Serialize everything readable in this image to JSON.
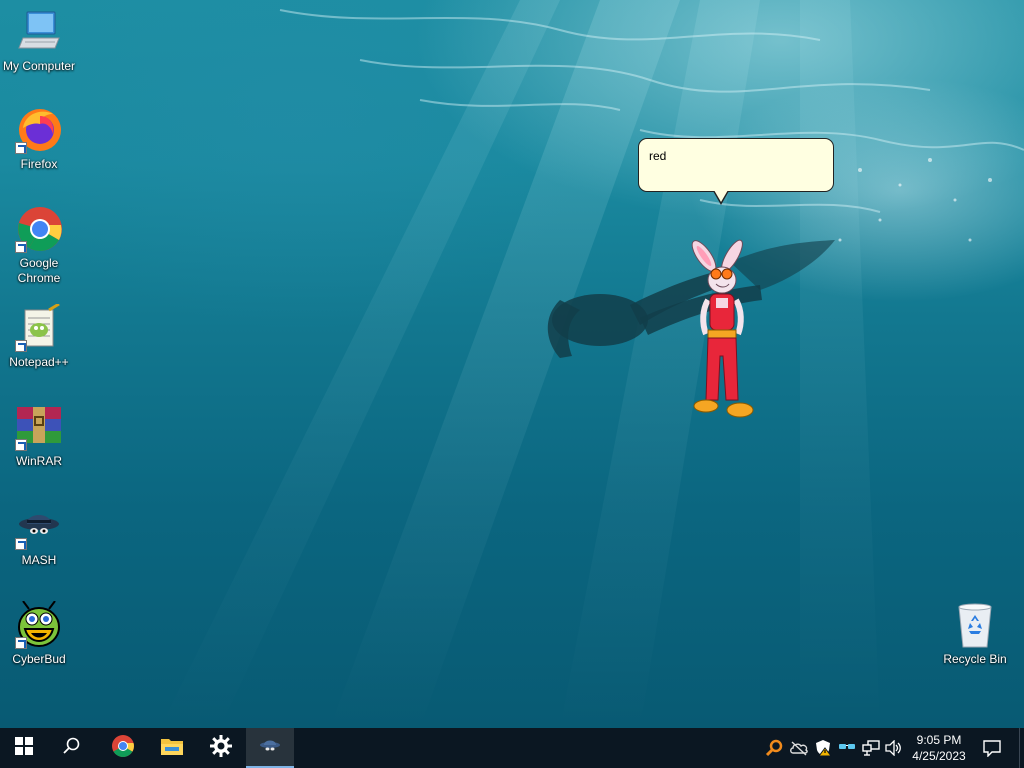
{
  "desktop": {
    "icons": [
      {
        "label": "My Computer",
        "icon": "computer-icon"
      },
      {
        "label": "Firefox",
        "icon": "firefox-icon"
      },
      {
        "label": "Google\nChrome",
        "icon": "chrome-icon"
      },
      {
        "label": "Notepad++",
        "icon": "notepadpp-icon"
      },
      {
        "label": "WinRAR",
        "icon": "winrar-icon"
      },
      {
        "label": "MASH",
        "icon": "mash-icon"
      },
      {
        "label": "CyberBud",
        "icon": "cyberbud-icon"
      },
      {
        "label": "Recycle Bin",
        "icon": "recycle-bin-icon"
      }
    ]
  },
  "agent": {
    "balloon_text": "red",
    "character": "rabbit-agent"
  },
  "taskbar": {
    "buttons": [
      {
        "name": "start-button",
        "icon": "windows-logo-icon"
      },
      {
        "name": "search-button",
        "icon": "search-icon"
      },
      {
        "name": "taskbar-chrome",
        "icon": "chrome-icon"
      },
      {
        "name": "taskbar-file-explorer",
        "icon": "folder-icon"
      },
      {
        "name": "taskbar-settings",
        "icon": "gear-icon"
      },
      {
        "name": "taskbar-mash",
        "icon": "mash-icon"
      }
    ],
    "tray": [
      "search-tray-icon",
      "cloud-offline-icon",
      "security-shield-icon",
      "agent-tray-icon",
      "network-icon",
      "volume-icon"
    ],
    "clock": {
      "time": "9:05 PM",
      "date": "4/25/2023"
    },
    "notification": "action-center-icon"
  },
  "colors": {
    "taskbar": "#0b1722",
    "balloon": "#ffffe1",
    "water": "#12778f"
  }
}
